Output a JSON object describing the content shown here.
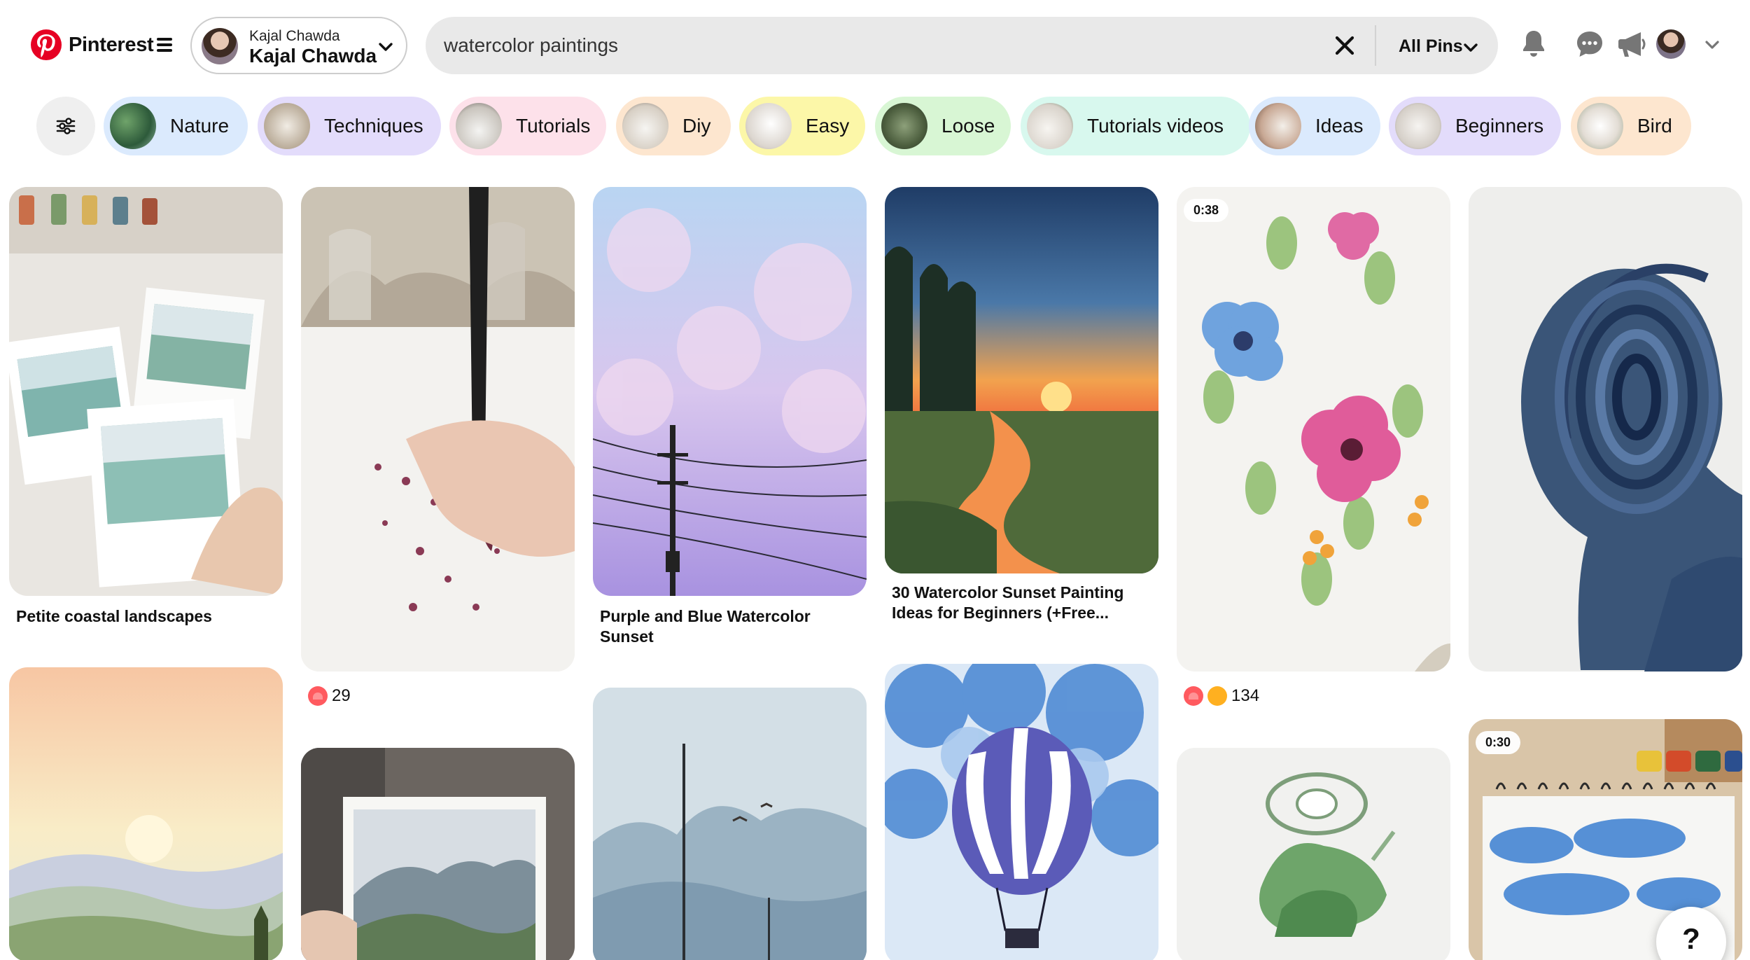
{
  "header": {
    "brand": "Pinterest",
    "account": {
      "small_name": "Kajal Chawda",
      "big_name": "Kajal Chawda"
    },
    "search": {
      "value": "watercolor paintings",
      "scope": "All Pins"
    },
    "icons": [
      "notifications-bell-icon",
      "messages-icon",
      "updates-megaphone-icon",
      "profile-avatar",
      "account-menu-chevron-icon"
    ]
  },
  "chips": [
    {
      "label": "Nature",
      "color": "#dbeafd"
    },
    {
      "label": "Techniques",
      "color": "#e3dcfb"
    },
    {
      "label": "Tutorials",
      "color": "#fde1ea"
    },
    {
      "label": "Diy",
      "color": "#fde6cf"
    },
    {
      "label": "Easy",
      "color": "#fcf7a8"
    },
    {
      "label": "Loose",
      "color": "#d8f6d4"
    },
    {
      "label": "Tutorials videos",
      "color": "#d8f8ee"
    },
    {
      "label": "Ideas",
      "color": "#dbeafd"
    },
    {
      "label": "Beginners",
      "color": "#e3dcfb"
    },
    {
      "label": "Bird",
      "color": "#fde6cf"
    }
  ],
  "pins": {
    "p1": {
      "title": "Petite coastal landscapes"
    },
    "p2": {
      "reaction_count": "29"
    },
    "p3": {
      "title": "Purple and Blue Watercolor Sunset"
    },
    "p4": {
      "title": "30 Watercolor Sunset Painting Ideas for Beginners (+Free..."
    },
    "p5": {
      "duration": "0:38",
      "reaction_count": "134"
    },
    "p10": {
      "duration": "0:30"
    }
  },
  "help": {
    "label": "?"
  }
}
